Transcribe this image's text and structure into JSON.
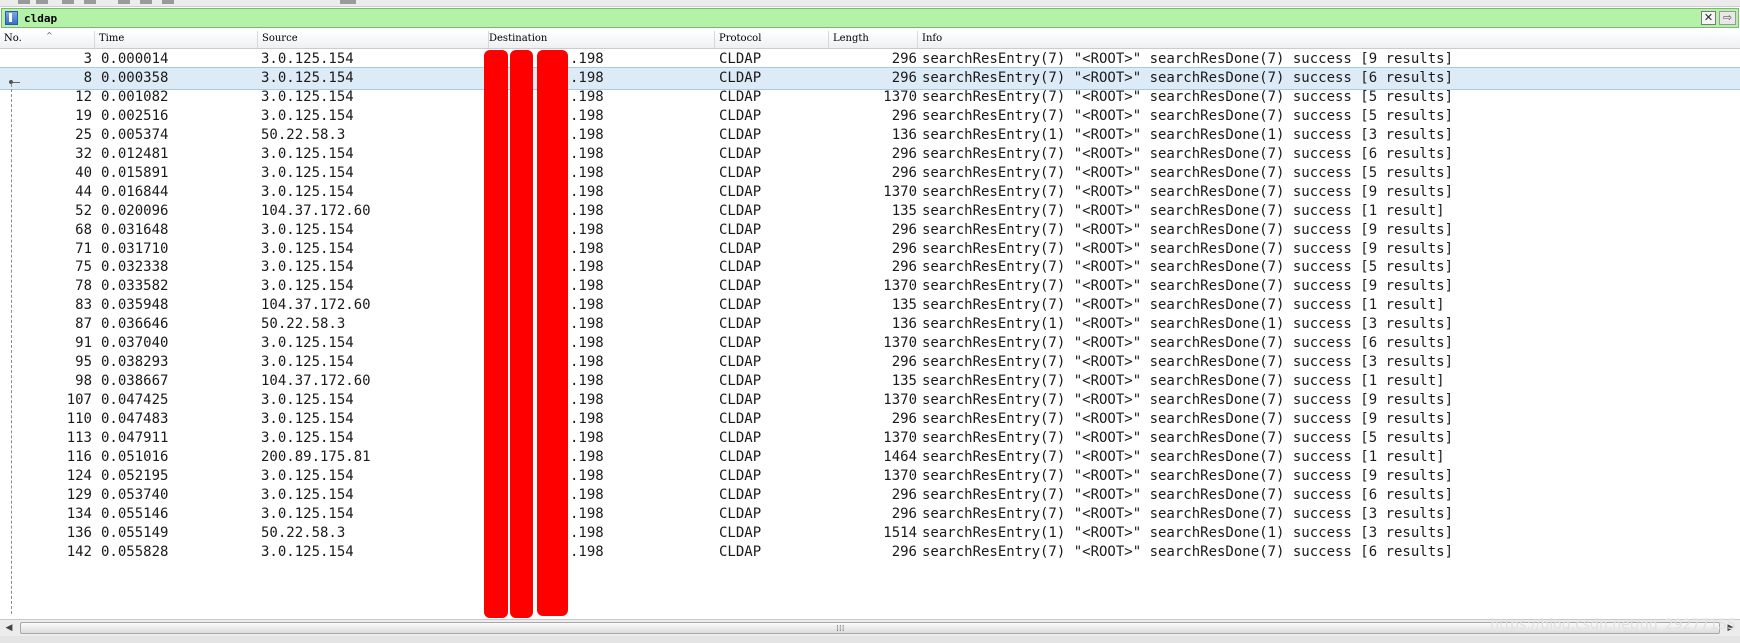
{
  "filter": {
    "value": "cldap"
  },
  "columns": {
    "no": "No.",
    "time": "Time",
    "source": "Source",
    "destination": "Destination",
    "protocol": "Protocol",
    "length": "Length",
    "info": "Info"
  },
  "packets": [
    {
      "no": "3",
      "time": "0.000014",
      "src": "3.0.125.154",
      "dst": ".198",
      "proto": "CLDAP",
      "len": "296",
      "info": "searchResEntry(7) \"<ROOT>\" searchResDone(7) success  [9 results]"
    },
    {
      "no": "8",
      "time": "0.000358",
      "src": "3.0.125.154",
      "dst": ".198",
      "proto": "CLDAP",
      "len": "296",
      "info": "searchResEntry(7) \"<ROOT>\" searchResDone(7) success  [6 results]"
    },
    {
      "no": "12",
      "time": "0.001082",
      "src": "3.0.125.154",
      "dst": ".198",
      "proto": "CLDAP",
      "len": "1370",
      "info": "searchResEntry(7) \"<ROOT>\" searchResDone(7) success  [5 results]"
    },
    {
      "no": "19",
      "time": "0.002516",
      "src": "3.0.125.154",
      "dst": ".198",
      "proto": "CLDAP",
      "len": "296",
      "info": "searchResEntry(7) \"<ROOT>\" searchResDone(7) success  [5 results]"
    },
    {
      "no": "25",
      "time": "0.005374",
      "src": "50.22.58.3",
      "dst": ".198",
      "proto": "CLDAP",
      "len": "136",
      "info": "searchResEntry(1) \"<ROOT>\" searchResDone(1) success  [3 results]"
    },
    {
      "no": "32",
      "time": "0.012481",
      "src": "3.0.125.154",
      "dst": ".198",
      "proto": "CLDAP",
      "len": "296",
      "info": "searchResEntry(7) \"<ROOT>\" searchResDone(7) success  [6 results]"
    },
    {
      "no": "40",
      "time": "0.015891",
      "src": "3.0.125.154",
      "dst": ".198",
      "proto": "CLDAP",
      "len": "296",
      "info": "searchResEntry(7) \"<ROOT>\" searchResDone(7) success  [5 results]"
    },
    {
      "no": "44",
      "time": "0.016844",
      "src": "3.0.125.154",
      "dst": ".198",
      "proto": "CLDAP",
      "len": "1370",
      "info": "searchResEntry(7) \"<ROOT>\" searchResDone(7) success  [9 results]"
    },
    {
      "no": "52",
      "time": "0.020096",
      "src": "104.37.172.60",
      "dst": ".198",
      "proto": "CLDAP",
      "len": "135",
      "info": "searchResEntry(7) \"<ROOT>\" searchResDone(7) success  [1 result]"
    },
    {
      "no": "68",
      "time": "0.031648",
      "src": "3.0.125.154",
      "dst": ".198",
      "proto": "CLDAP",
      "len": "296",
      "info": "searchResEntry(7) \"<ROOT>\" searchResDone(7) success  [9 results]"
    },
    {
      "no": "71",
      "time": "0.031710",
      "src": "3.0.125.154",
      "dst": ".198",
      "proto": "CLDAP",
      "len": "296",
      "info": "searchResEntry(7) \"<ROOT>\" searchResDone(7) success  [9 results]"
    },
    {
      "no": "75",
      "time": "0.032338",
      "src": "3.0.125.154",
      "dst": ".198",
      "proto": "CLDAP",
      "len": "296",
      "info": "searchResEntry(7) \"<ROOT>\" searchResDone(7) success  [5 results]"
    },
    {
      "no": "78",
      "time": "0.033582",
      "src": "3.0.125.154",
      "dst": ".198",
      "proto": "CLDAP",
      "len": "1370",
      "info": "searchResEntry(7) \"<ROOT>\" searchResDone(7) success  [9 results]"
    },
    {
      "no": "83",
      "time": "0.035948",
      "src": "104.37.172.60",
      "dst": ".198",
      "proto": "CLDAP",
      "len": "135",
      "info": "searchResEntry(7) \"<ROOT>\" searchResDone(7) success  [1 result]"
    },
    {
      "no": "87",
      "time": "0.036646",
      "src": "50.22.58.3",
      "dst": ".198",
      "proto": "CLDAP",
      "len": "136",
      "info": "searchResEntry(1) \"<ROOT>\" searchResDone(1) success  [3 results]"
    },
    {
      "no": "91",
      "time": "0.037040",
      "src": "3.0.125.154",
      "dst": ".198",
      "proto": "CLDAP",
      "len": "1370",
      "info": "searchResEntry(7) \"<ROOT>\" searchResDone(7) success  [6 results]"
    },
    {
      "no": "95",
      "time": "0.038293",
      "src": "3.0.125.154",
      "dst": ".198",
      "proto": "CLDAP",
      "len": "296",
      "info": "searchResEntry(7) \"<ROOT>\" searchResDone(7) success  [3 results]"
    },
    {
      "no": "98",
      "time": "0.038667",
      "src": "104.37.172.60",
      "dst": ".198",
      "proto": "CLDAP",
      "len": "135",
      "info": "searchResEntry(7) \"<ROOT>\" searchResDone(7) success  [1 result]"
    },
    {
      "no": "107",
      "time": "0.047425",
      "src": "3.0.125.154",
      "dst": ".198",
      "proto": "CLDAP",
      "len": "1370",
      "info": "searchResEntry(7) \"<ROOT>\" searchResDone(7) success  [9 results]"
    },
    {
      "no": "110",
      "time": "0.047483",
      "src": "3.0.125.154",
      "dst": ".198",
      "proto": "CLDAP",
      "len": "296",
      "info": "searchResEntry(7) \"<ROOT>\" searchResDone(7) success  [9 results]"
    },
    {
      "no": "113",
      "time": "0.047911",
      "src": "3.0.125.154",
      "dst": ".198",
      "proto": "CLDAP",
      "len": "1370",
      "info": "searchResEntry(7) \"<ROOT>\" searchResDone(7) success  [5 results]"
    },
    {
      "no": "116",
      "time": "0.051016",
      "src": "200.89.175.81",
      "dst": ".198",
      "proto": "CLDAP",
      "len": "1464",
      "info": "searchResEntry(7) \"<ROOT>\" searchResDone(7) success  [1 result]"
    },
    {
      "no": "124",
      "time": "0.052195",
      "src": "3.0.125.154",
      "dst": ".198",
      "proto": "CLDAP",
      "len": "1370",
      "info": "searchResEntry(7) \"<ROOT>\" searchResDone(7) success  [9 results]"
    },
    {
      "no": "129",
      "time": "0.053740",
      "src": "3.0.125.154",
      "dst": ".198",
      "proto": "CLDAP",
      "len": "296",
      "info": "searchResEntry(7) \"<ROOT>\" searchResDone(7) success  [6 results]"
    },
    {
      "no": "134",
      "time": "0.055146",
      "src": "3.0.125.154",
      "dst": ".198",
      "proto": "CLDAP",
      "len": "296",
      "info": "searchResEntry(7) \"<ROOT>\" searchResDone(7) success  [3 results]"
    },
    {
      "no": "136",
      "time": "0.055149",
      "src": "50.22.58.3",
      "dst": ".198",
      "proto": "CLDAP",
      "len": "1514",
      "info": "searchResEntry(1) \"<ROOT>\" searchResDone(1) success  [3 results]"
    },
    {
      "no": "142",
      "time": "0.055828",
      "src": "3.0.125.154",
      "dst": ".198",
      "proto": "CLDAP",
      "len": "296",
      "info": "searchResEntry(7) \"<ROOT>\" searchResDone(7) success  [6 results]"
    }
  ],
  "selected_packet": "8",
  "icons": {
    "bookmark": "bookmark-icon",
    "clear": "clear-filter-icon",
    "apply": "apply-filter-icon",
    "sort": "sort-ascending-icon"
  },
  "colors": {
    "filter_valid": "#b4f2a8",
    "selected_row": "#ddebf7",
    "redaction": "#ff0000"
  },
  "scrollbar": {
    "left": "◀",
    "right": "▶",
    "grip": "⁞⁞⁞"
  },
  "glyphs": {
    "clear": "✕",
    "apply": "⇨",
    "sort": "^"
  },
  "watermark": "https://blog.csdn.net/qq_29277155"
}
